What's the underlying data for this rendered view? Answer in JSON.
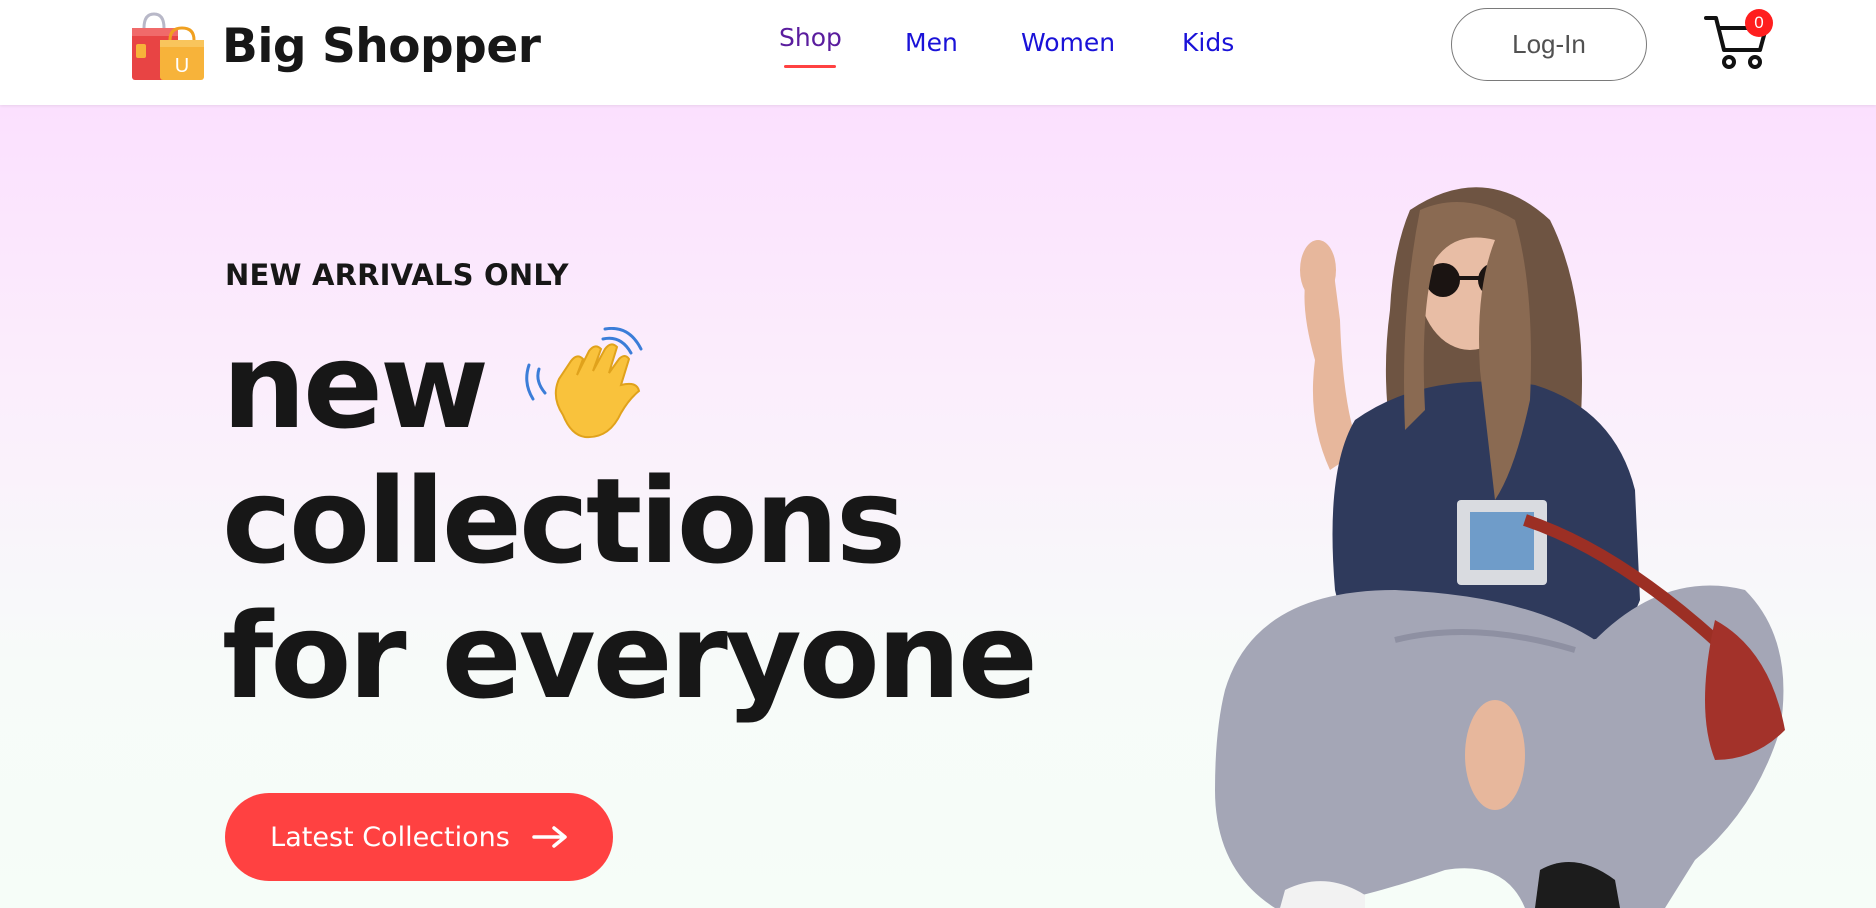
{
  "brand": {
    "name": "Big Shopper",
    "logo_icon": "shopping-bags-icon",
    "logo_letter": "U"
  },
  "nav": {
    "items": [
      {
        "label": "Shop",
        "active": true
      },
      {
        "label": "Men",
        "active": false
      },
      {
        "label": "Women",
        "active": false
      },
      {
        "label": "Kids",
        "active": false
      }
    ]
  },
  "header": {
    "login_label": "Log-In",
    "cart_icon": "cart-icon",
    "cart_count": "0"
  },
  "hero": {
    "eyebrow": "NEW ARRIVALS ONLY",
    "headline": [
      "new",
      "collections",
      "for everyone"
    ],
    "hand_icon": "waving-hand-icon",
    "cta_label": "Latest Collections",
    "cta_icon": "arrow-right-icon",
    "image": "model-photo"
  },
  "colors": {
    "accent": "#ff4141",
    "nav_link": "#1a12d8",
    "nav_active": "#5a1d9e",
    "text": "#171717",
    "hero_top": "#fbe0fe",
    "hero_bottom": "#f6fdf8"
  }
}
